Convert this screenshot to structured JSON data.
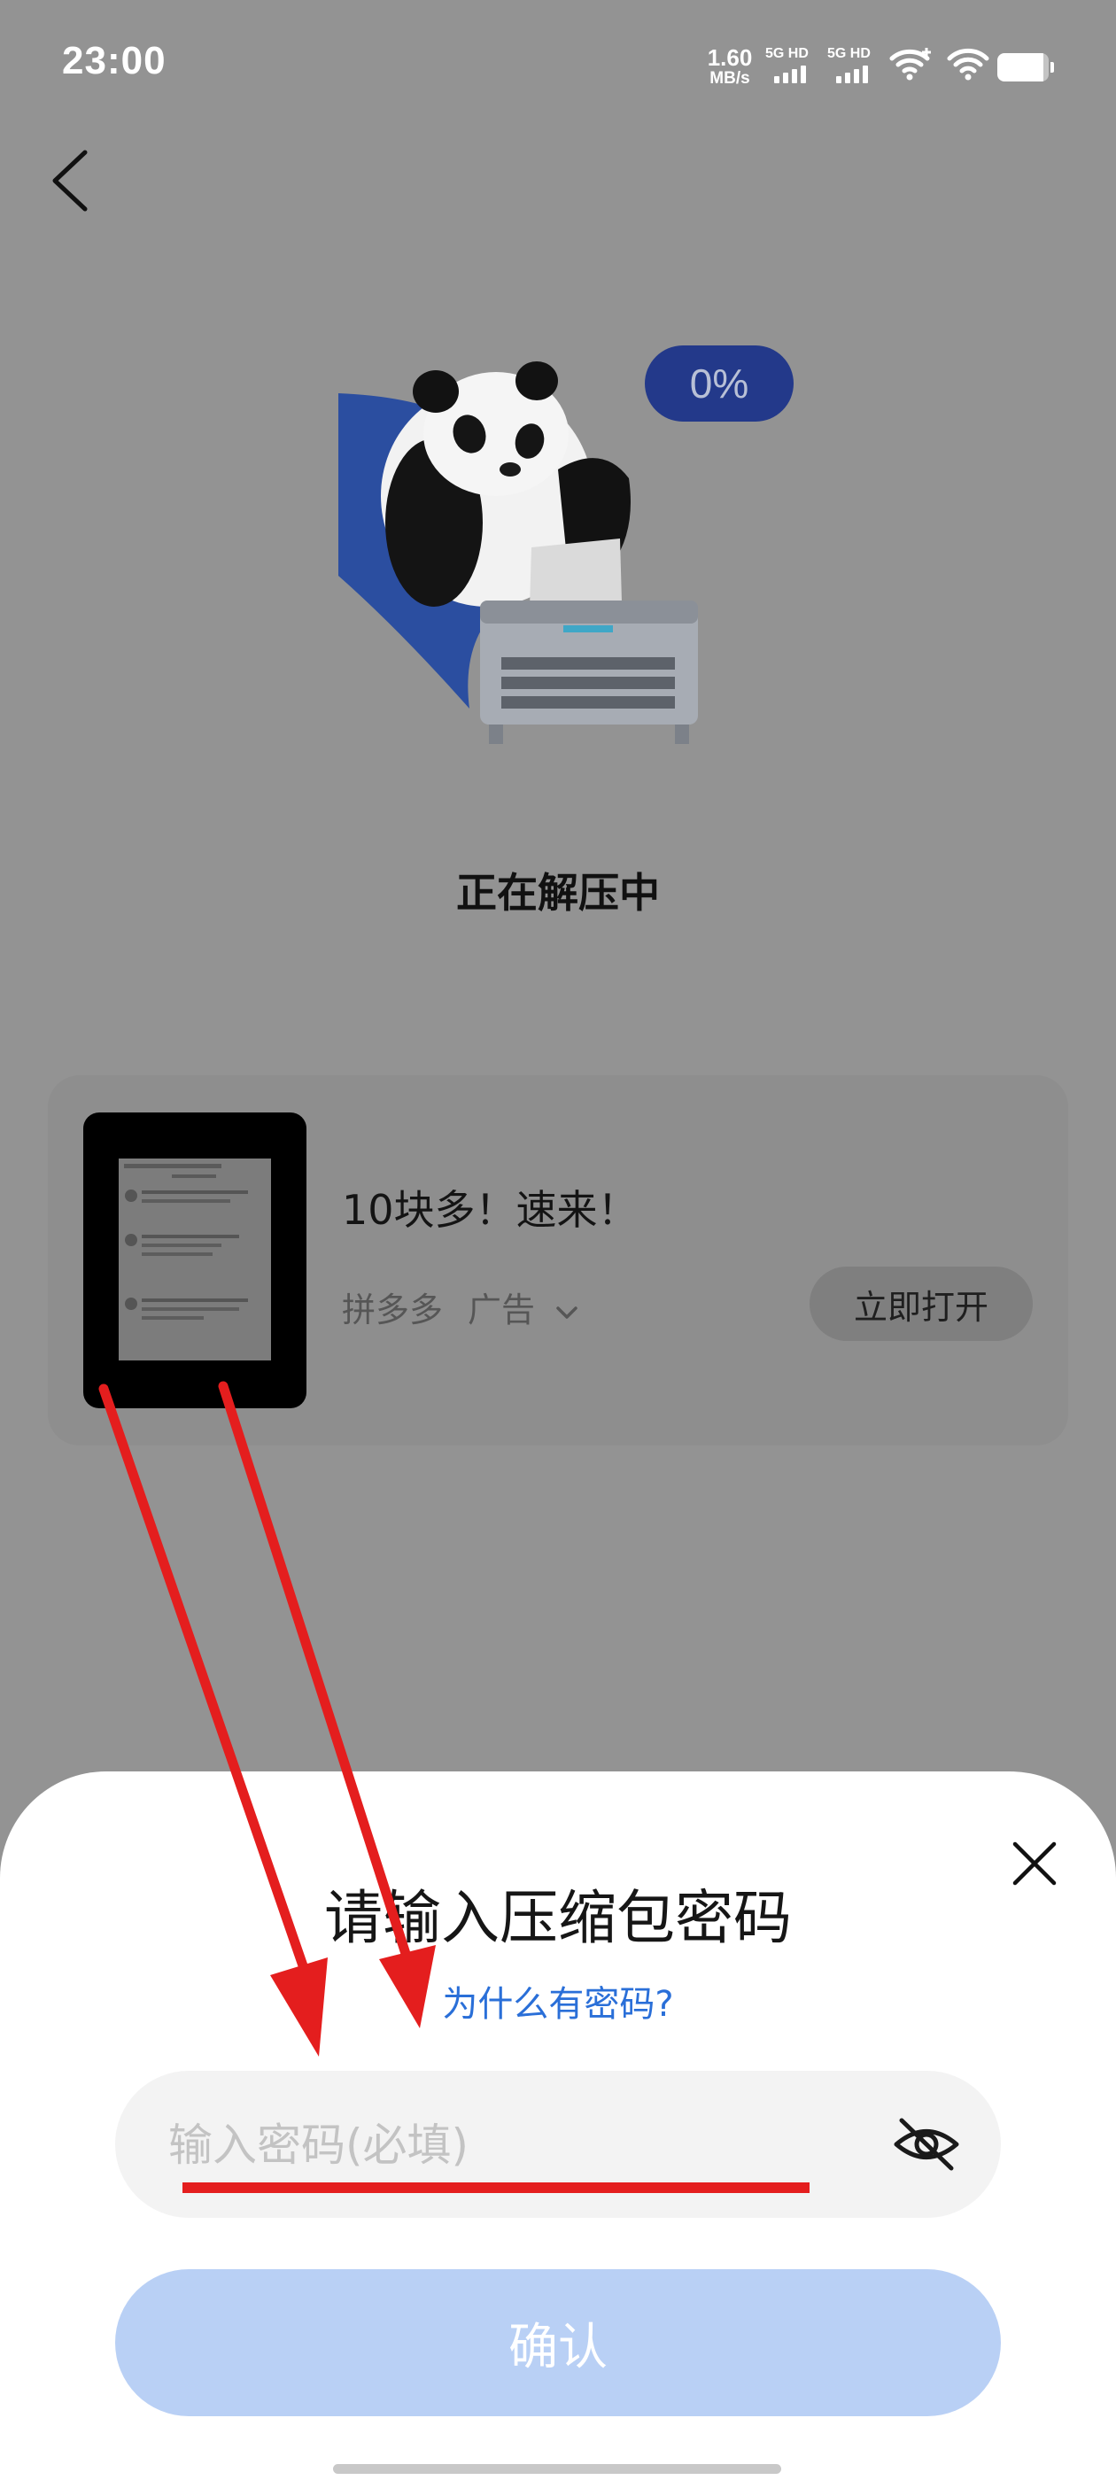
{
  "status_bar": {
    "time": "23:00",
    "net_speed_value": "1.60",
    "net_speed_unit": "MB/s",
    "sim1_label": "5G HD",
    "sim2_label": "5G HD",
    "battery_level": 0.9
  },
  "illustration": {
    "progress": "0%",
    "status": "正在解压中"
  },
  "ad": {
    "title": "10块多！速来！",
    "source": "拼多多",
    "label": "广告",
    "open_label": "立即打开"
  },
  "dialog": {
    "title": "请输入压缩包密码",
    "why_link": "为什么有密码?",
    "password_placeholder": "输入密码(必填)",
    "password_value": "",
    "confirm_label": "确认"
  },
  "colors": {
    "annotation_red": "#e41e1e",
    "link_blue": "#2a6fd8",
    "confirm_disabled": "#b9d0f5",
    "badge_blue": "#23398a"
  }
}
